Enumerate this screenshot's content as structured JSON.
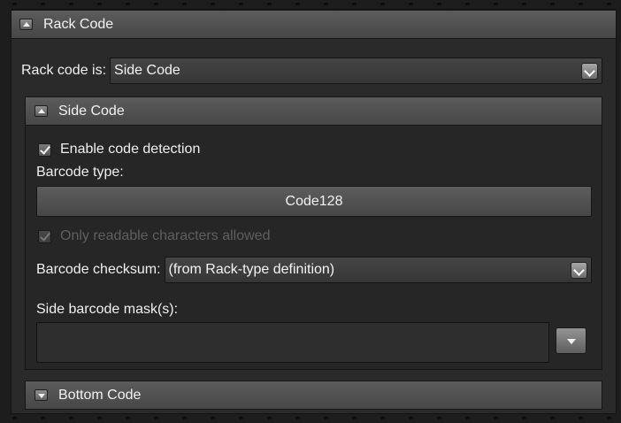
{
  "rack_section": {
    "title": "Rack Code",
    "rack_code_label": "Rack code is:",
    "rack_code_value": "Side Code"
  },
  "side_section": {
    "title": "Side Code",
    "enable_detection_label": "Enable code detection",
    "enable_detection_checked": true,
    "barcode_type_label": "Barcode type:",
    "barcode_type_value": "Code128",
    "readable_only_label": "Only readable characters allowed",
    "readable_only_checked": true,
    "readable_only_enabled": false,
    "checksum_label": "Barcode checksum:",
    "checksum_value": "(from Rack-type definition)",
    "mask_label": "Side barcode mask(s):",
    "mask_value": ""
  },
  "bottom_section": {
    "title": "Bottom Code"
  },
  "icons": {
    "collapse": "collapse-up-icon",
    "expand": "expand-down-icon",
    "dropdown": "chevron-down-icon",
    "check": "checkmark-icon"
  }
}
